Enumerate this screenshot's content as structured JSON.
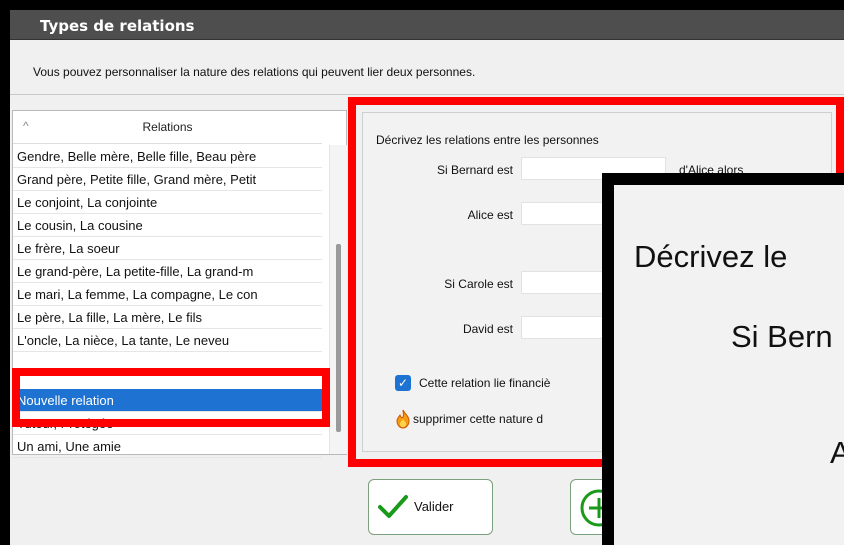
{
  "window": {
    "title": "Types de relations"
  },
  "subtitle": "Vous pouvez personnaliser la nature des relations qui peuvent lier deux personnes.",
  "list": {
    "header": "Relations",
    "items": [
      "Gendre, Belle mère, Belle fille, Beau père",
      "Grand père, Petite fille, Grand mère, Petit",
      "Le conjoint, La conjointe",
      "Le cousin, La cousine",
      "Le frère, La soeur",
      "Le grand-père, La petite-fille, La grand-m",
      "Le mari, La femme, La compagne, Le con",
      "Le père, La fille, La mère, Le fils",
      "L'oncle, La nièce, La tante, Le neveu",
      "Nouvelle relation",
      "Tuteur, Protégée",
      "Un ami, Une amie"
    ],
    "selected_index": 9
  },
  "panel": {
    "title": "Décrivez les relations entre les personnes",
    "row1_label": "Si Bernard est",
    "row1_suffix": "d'Alice alors",
    "row2_label": "Alice est",
    "row3_label": "Si Carole est",
    "row4_label": "David est",
    "checkbox_label": "Cette relation lie financiè",
    "delete_label": "supprimer cette nature d"
  },
  "buttons": {
    "valider": "Valider"
  },
  "zoom": {
    "title": "Décrivez le",
    "label1": "Si Bern",
    "label2": "A"
  },
  "colors": {
    "highlight": "#ff0000",
    "selection": "#1e73d2",
    "accent_green": "#1a9a1a"
  }
}
